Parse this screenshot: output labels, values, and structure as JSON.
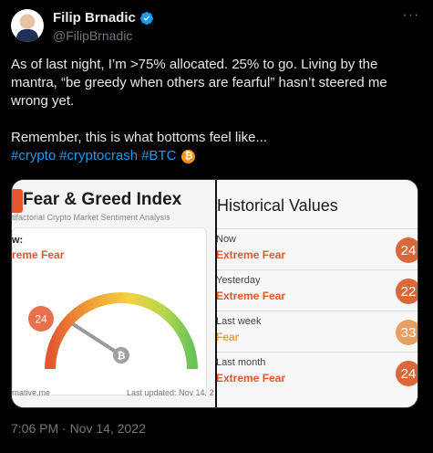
{
  "author": {
    "name": "Filip Brnadic",
    "handle": "@FilipBrnadic",
    "verified": true
  },
  "tweet": {
    "line1": "As of last night, I’m >75% allocated. 25% to go. Living by the",
    "line2": "mantra, “be greedy when others are fearful” hasn’t steered me",
    "line3": "wrong yet.",
    "line4": "Remember, this is what bottoms feel like...",
    "hashtags": [
      "#crypto",
      "#cryptocrash",
      "#BTC"
    ],
    "btc_emoji": "₿"
  },
  "media": {
    "fear_greed": {
      "title": "Fear & Greed Index",
      "subtitle": "tifactorial Crypto Market Sentiment Analysis",
      "now_label": "w:",
      "now_class": "reme Fear",
      "value": "24",
      "value_fraction": 0.24,
      "source": "rnative.me",
      "last_updated": "Last updated: Nov 14, 2"
    },
    "historical": {
      "title": "Historical Values",
      "rows": [
        {
          "label": "Now",
          "classification": "Extreme Fear",
          "value": "24",
          "color": "#d9683a"
        },
        {
          "label": "Yesterday",
          "classification": "Extreme Fear",
          "value": "22",
          "color": "#d9683a"
        },
        {
          "label": "Last week",
          "classification": "Fear",
          "value": "33",
          "color": "#e8a062"
        },
        {
          "label": "Last month",
          "classification": "Extreme Fear",
          "value": "24",
          "color": "#d9683a"
        }
      ]
    }
  },
  "timestamp": "7:06 PM · Nov 14, 2022",
  "colors": {
    "link": "#1d9bf0",
    "extreme_fear": "#e4572e",
    "fear": "#f2a33a",
    "btc": "#f7931a"
  }
}
